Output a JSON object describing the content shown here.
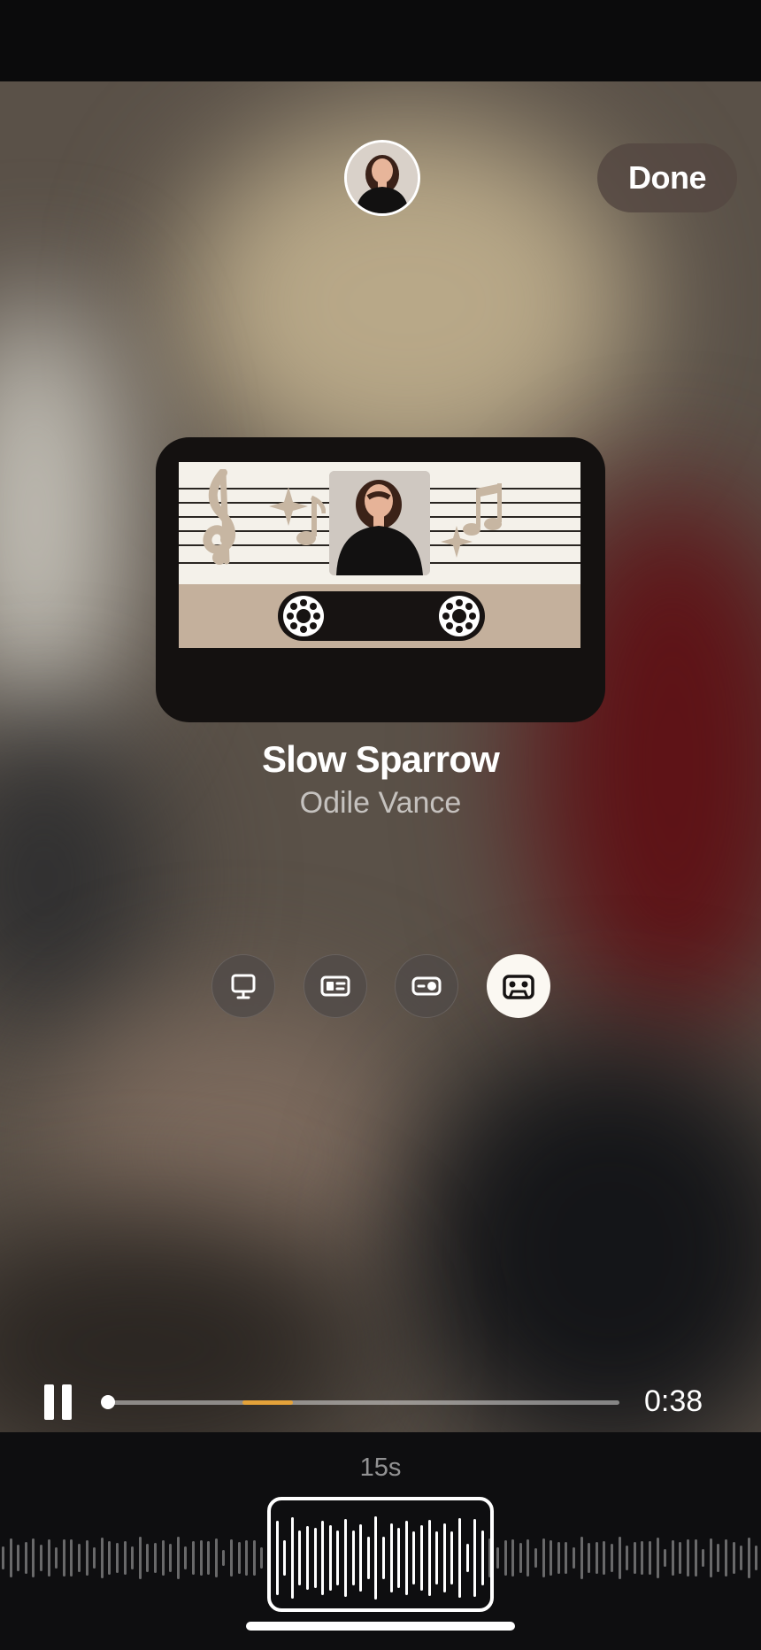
{
  "header": {
    "done_label": "Done"
  },
  "track": {
    "title": "Slow Sparrow",
    "artist": "Odile Vance"
  },
  "style_options": [
    {
      "icon": "monitor-icon",
      "active": false
    },
    {
      "icon": "card-icon",
      "active": false
    },
    {
      "icon": "toggle-card-icon",
      "active": false
    },
    {
      "icon": "cassette-icon",
      "active": true
    }
  ],
  "playback": {
    "state": "playing",
    "elapsed_display": "0:38",
    "clip_duration_label": "15s",
    "selection_fraction": [
      0.26,
      0.36
    ],
    "accent_color": "#e4a23a"
  }
}
